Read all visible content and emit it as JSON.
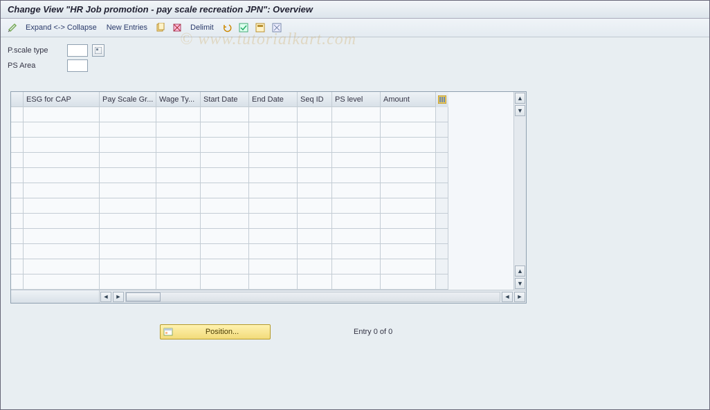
{
  "title": "Change View \"HR Job promotion - pay scale recreation JPN\": Overview",
  "toolbar": {
    "expand_label": "Expand <-> Collapse",
    "new_entries_label": "New Entries",
    "delimit_label": "Delimit"
  },
  "form": {
    "pscale_type_label": "P.scale type",
    "ps_area_label": "PS Area",
    "pscale_type_value": "",
    "ps_area_value": ""
  },
  "table": {
    "columns": [
      "ESG for CAP",
      "Pay Scale Gr...",
      "Wage Ty...",
      "Start Date",
      "End Date",
      "Seq ID",
      "PS level",
      "Amount"
    ],
    "rows": [
      [
        "",
        "",
        "",
        "",
        "",
        "",
        "",
        ""
      ],
      [
        "",
        "",
        "",
        "",
        "",
        "",
        "",
        ""
      ],
      [
        "",
        "",
        "",
        "",
        "",
        "",
        "",
        ""
      ],
      [
        "",
        "",
        "",
        "",
        "",
        "",
        "",
        ""
      ],
      [
        "",
        "",
        "",
        "",
        "",
        "",
        "",
        ""
      ],
      [
        "",
        "",
        "",
        "",
        "",
        "",
        "",
        ""
      ],
      [
        "",
        "",
        "",
        "",
        "",
        "",
        "",
        ""
      ],
      [
        "",
        "",
        "",
        "",
        "",
        "",
        "",
        ""
      ],
      [
        "",
        "",
        "",
        "",
        "",
        "",
        "",
        ""
      ],
      [
        "",
        "",
        "",
        "",
        "",
        "",
        "",
        ""
      ],
      [
        "",
        "",
        "",
        "",
        "",
        "",
        "",
        ""
      ],
      [
        "",
        "",
        "",
        "",
        "",
        "",
        "",
        ""
      ]
    ]
  },
  "footer": {
    "position_label": "Position...",
    "entry_text": "Entry 0 of 0"
  },
  "watermark": "© www.tutorialkart.com"
}
